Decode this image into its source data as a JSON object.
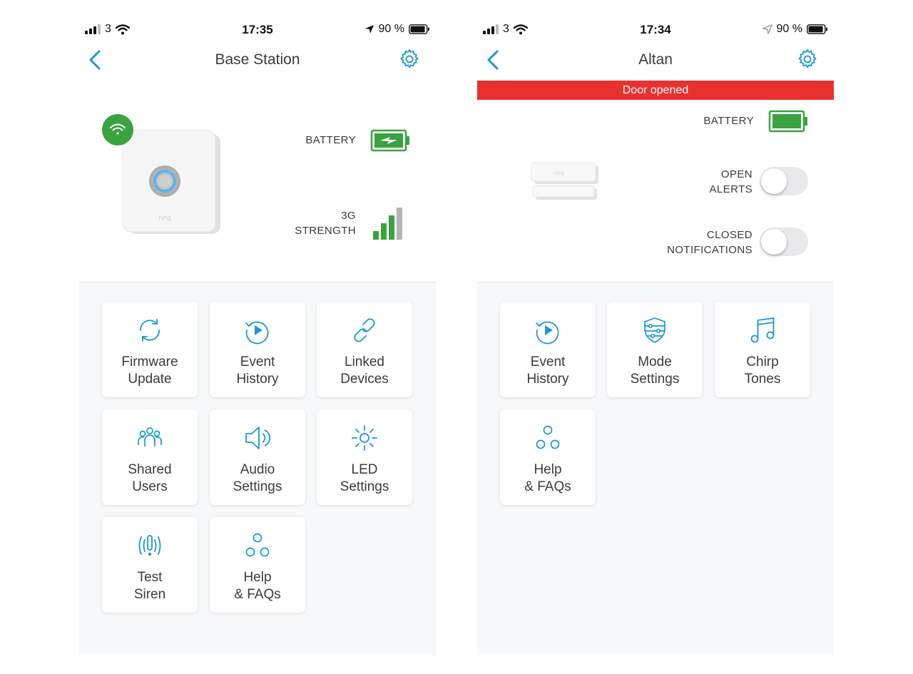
{
  "colors": {
    "accent": "#1998d5",
    "green": "#3aa241",
    "red": "#e8312e",
    "gray": "#b5b5b5"
  },
  "left": {
    "status": {
      "carrier": "3",
      "time": "17:35",
      "battery": "90 %"
    },
    "title": "Base Station",
    "battery_label": "BATTERY",
    "strength_label": "3G\nSTRENGTH",
    "signal_bars_filled": 3,
    "signal_bars_total": 4,
    "tiles": [
      {
        "label": "Firmware\nUpdate",
        "icon": "refresh-icon"
      },
      {
        "label": "Event\nHistory",
        "icon": "history-icon"
      },
      {
        "label": "Linked\nDevices",
        "icon": "link-icon"
      },
      {
        "label": "Shared\nUsers",
        "icon": "users-icon"
      },
      {
        "label": "Audio\nSettings",
        "icon": "speaker-icon"
      },
      {
        "label": "LED\nSettings",
        "icon": "sun-icon"
      },
      {
        "label": "Test\nSiren",
        "icon": "siren-icon"
      },
      {
        "label": "Help\n& FAQs",
        "icon": "help-icon"
      }
    ]
  },
  "right": {
    "status": {
      "carrier": "3",
      "time": "17:34",
      "battery": "90 %"
    },
    "title": "Altan",
    "banner": "Door opened",
    "battery_label": "BATTERY",
    "open_alerts_label": "OPEN\nALERTS",
    "closed_notifications_label": "CLOSED\nNOTIFICATIONS",
    "open_alerts_on": false,
    "closed_notifications_on": false,
    "tiles": [
      {
        "label": "Event\nHistory",
        "icon": "history-icon"
      },
      {
        "label": "Mode\nSettings",
        "icon": "shield-sliders-icon"
      },
      {
        "label": "Chirp\nTones",
        "icon": "music-note-icon"
      },
      {
        "label": "Help\n& FAQs",
        "icon": "help-icon"
      }
    ]
  }
}
